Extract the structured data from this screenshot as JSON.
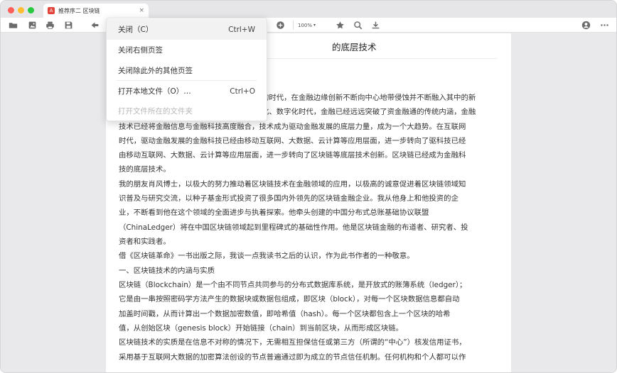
{
  "tab": {
    "icon_text": "A",
    "title": "推荐序二 区块链",
    "close": "×"
  },
  "toolbar": {
    "zoom": "100%",
    "zoom_arrow": "▾"
  },
  "document": {
    "title_visible": "的底层技术",
    "paragraphs": [
      "的时代，在金融边缘创新不断向中心地带侵蚀并不断融入其中的新",
      "化、数字化时代，金融已经远远突破了资金融通的传统内涵，金融",
      "技术已经将金融信息与金融科技高度融合，技术成为驱动金融发展的底层力量，成为一个大趋势。在互联网",
      "时代，驱动金融发展的金融科技已经由移动互联网、大数据、云计算等应用层面，进一步转向了驱科技已经",
      "由移动互联网、大数据、云计算等应用层面，进一步转向了区块链等底层技术创新。区块链已经成为金融科",
      "技的底层技术。",
      "我的朋友肖风博士，以极大的努力推动着区块链技术在金融领域的应用，以极高的诚意促进着区块链领域知",
      "识普及与研究交流，以种子基金形式投资了很多国内外领先的区块链金融企业。我从他身上和他投资的企",
      "业，不断看到他在这个领域的全面进步与执着探索。他牵头创建的中国分布式总账基础协议联盟",
      "（ChinaLedger）将在中国区块链领域起到里程碑式的基础性作用。他是区块链金融的布道者、研究者、投",
      "资者和实践者。",
      "借《区块链革命》一书出版之际，我谈一点我读书之后的认识，作为此书作者的一种敬意。",
      "一、区块链技术的内涵与实质",
      "区块链（Blockchain）是一个由不同节点共同参与的分布式数据库系统，是开放式的账簿系统（ledger）；",
      "它是由一串按照密码学方法产生的数据块或数据包组成，即区块（block），对每一个区块数据信息都自动",
      "加盖时间戳，从而计算出一个数据加密数值，即哈希值（hash）。每一个区块都包含上一个区块的哈希",
      "值，从创始区块（genesis block）开始链接（chain）到当前区块，从而形成区块链。",
      "区块链技术的实质是在信息不对称的情况下，无需相互担保信任或第三方（所谓的“中心”）核发信用证书，",
      "采用基于互联网大数据的加密算法创设的节点普遍通过即为成立的节点信任机制。任何机构和个人都可以作"
    ]
  },
  "context_menu": {
    "items": [
      {
        "label": "关闭（C）",
        "shortcut": "Ctrl+W"
      },
      {
        "label": "关闭右侧页签",
        "shortcut": ""
      },
      {
        "label": "关闭除此外的其他页签",
        "shortcut": ""
      },
      {
        "label": "打开本地文件（O）…",
        "shortcut": "Ctrl+O"
      },
      {
        "label": "打开文件所在的文件夹",
        "shortcut": ""
      }
    ]
  }
}
